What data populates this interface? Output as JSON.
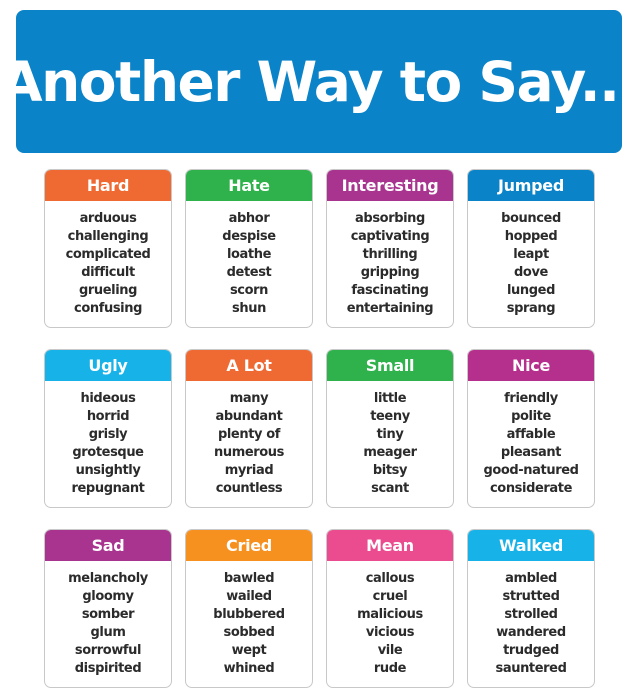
{
  "title": "Another Way to Say...",
  "colors": {
    "banner": "#0a83c8",
    "orange_red": "#ef6a33",
    "green": "#2fb24c",
    "purple": "#a8348f",
    "blue": "#0a83c8",
    "cyan": "#17b3e8",
    "orange": "#f6901e",
    "pink": "#ea4c8f",
    "magenta": "#b52f8d"
  },
  "cards": [
    {
      "heading": "Hard",
      "color": "#ef6a33",
      "words": [
        "arduous",
        "challenging",
        "complicated",
        "difficult",
        "grueling",
        "confusing"
      ]
    },
    {
      "heading": "Hate",
      "color": "#2fb24c",
      "words": [
        "abhor",
        "despise",
        "loathe",
        "detest",
        "scorn",
        "shun"
      ]
    },
    {
      "heading": "Interesting",
      "color": "#a8348f",
      "words": [
        "absorbing",
        "captivating",
        "thrilling",
        "gripping",
        "fascinating",
        "entertaining"
      ]
    },
    {
      "heading": "Jumped",
      "color": "#0a83c8",
      "words": [
        "bounced",
        "hopped",
        "leapt",
        "dove",
        "lunged",
        "sprang"
      ]
    },
    {
      "heading": "Ugly",
      "color": "#17b3e8",
      "words": [
        "hideous",
        "horrid",
        "grisly",
        "grotesque",
        "unsightly",
        "repugnant"
      ]
    },
    {
      "heading": "A Lot",
      "color": "#ef6a33",
      "words": [
        "many",
        "abundant",
        "plenty of",
        "numerous",
        "myriad",
        "countless"
      ]
    },
    {
      "heading": "Small",
      "color": "#2fb24c",
      "words": [
        "little",
        "teeny",
        "tiny",
        "meager",
        "bitsy",
        "scant"
      ]
    },
    {
      "heading": "Nice",
      "color": "#b52f8d",
      "words": [
        "friendly",
        "polite",
        "affable",
        "pleasant",
        "good-natured",
        "considerate"
      ]
    },
    {
      "heading": "Sad",
      "color": "#a8348f",
      "words": [
        "melancholy",
        "gloomy",
        "somber",
        "glum",
        "sorrowful",
        "dispirited"
      ]
    },
    {
      "heading": "Cried",
      "color": "#f6901e",
      "words": [
        "bawled",
        "wailed",
        "blubbered",
        "sobbed",
        "wept",
        "whined"
      ]
    },
    {
      "heading": "Mean",
      "color": "#ea4c8f",
      "words": [
        "callous",
        "cruel",
        "malicious",
        "vicious",
        "vile",
        "rude"
      ]
    },
    {
      "heading": "Walked",
      "color": "#17b3e8",
      "words": [
        "ambled",
        "strutted",
        "strolled",
        "wandered",
        "trudged",
        "sauntered"
      ]
    }
  ]
}
